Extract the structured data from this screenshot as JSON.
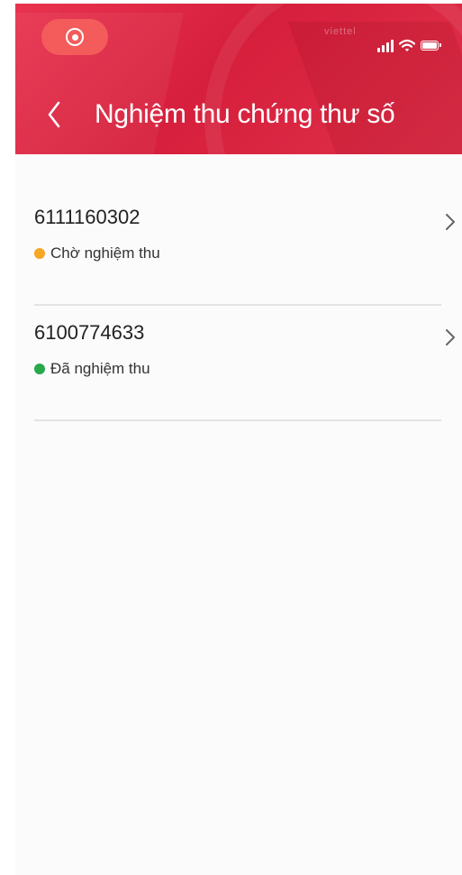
{
  "header": {
    "title": "Nghiệm thu chứng thư số",
    "brand_text": "viettel",
    "background_color": "#e0314a",
    "back_icon": "chevron-left-icon"
  },
  "status_bar": {
    "recording_icon": "screen-record-icon",
    "signal_icon": "cellular-signal-icon",
    "wifi_icon": "wifi-icon",
    "battery_icon": "battery-icon"
  },
  "items": [
    {
      "id": "6111160302",
      "status": "Chờ nghiệm thu",
      "status_color": "#f5a623"
    },
    {
      "id": "6100774633",
      "status": "Đã nghiệm thu",
      "status_color": "#27a84a"
    }
  ]
}
